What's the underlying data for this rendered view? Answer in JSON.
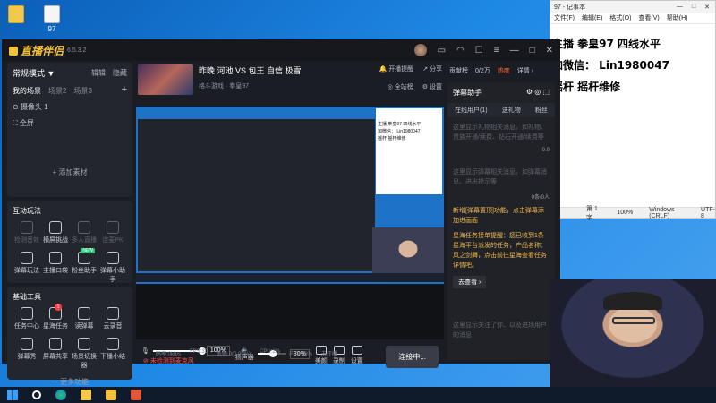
{
  "desktop": {
    "icons": [
      {
        "label": "",
        "kind": "file"
      },
      {
        "label": "97",
        "kind": "doc"
      }
    ]
  },
  "notepad": {
    "title": "97 - 记事本",
    "window_controls": [
      "—",
      "□",
      "✕"
    ],
    "menu": [
      "文件(F)",
      "编辑(E)",
      "格式(O)",
      "查看(V)",
      "帮助(H)"
    ],
    "lines": [
      "主播 拳皇97 四线水平",
      "加微信：  Lin1980047",
      "摇杆  摇杆维修"
    ],
    "status": {
      "position": "第 1 字",
      "zoom": "100%",
      "eol": "Windows (CRLF)",
      "encoding": "UTF-8"
    }
  },
  "app": {
    "logo": "直播伴侣",
    "version": "6.5.3.2",
    "titlebar_icons": [
      "avatar-icon",
      "chat-icon",
      "headset-icon",
      "feedback-icon",
      "menu-icon",
      "minimize-icon",
      "maximize-icon",
      "close-icon"
    ],
    "scenes": {
      "mode": "常规模式 ▼",
      "edit": "辑辑",
      "delete": "隐藏",
      "tabs": [
        "我的场景",
        "场景2",
        "场景3"
      ],
      "add": "+",
      "sources": [
        "摄像头 1",
        "全屏"
      ],
      "add_source": "+ 添加素材"
    },
    "interactive": {
      "title": "互动玩法",
      "tools": [
        {
          "label": "检测音效",
          "dim": true,
          "icon": "mic-icon"
        },
        {
          "label": "横屏挑战",
          "dim": false,
          "icon": "shield-icon"
        },
        {
          "label": "多人直播",
          "dim": true,
          "icon": "people-icon"
        },
        {
          "label": "连麦PK",
          "dim": true,
          "icon": "pk-icon"
        },
        {
          "label": "弹幕玩法",
          "dim": false,
          "icon": "download-icon"
        },
        {
          "label": "主播口袋",
          "dim": false,
          "icon": "pocket-icon"
        },
        {
          "label": "粉丝助手",
          "dim": false,
          "icon": "heart-icon",
          "badge": "NEW"
        },
        {
          "label": "弹幕小助手",
          "dim": false,
          "icon": "robot-icon"
        }
      ]
    },
    "basic": {
      "title": "基础工具",
      "tools": [
        {
          "label": "任务中心",
          "icon": "task-icon"
        },
        {
          "label": "星海任务",
          "icon": "ad-icon",
          "badge_num": "1"
        },
        {
          "label": "读弹幕",
          "icon": "read-icon"
        },
        {
          "label": "云录音",
          "icon": "cloud-icon"
        },
        {
          "label": "弹幕秀",
          "icon": "show-icon"
        },
        {
          "label": "屏幕共享",
          "icon": "share-icon"
        },
        {
          "label": "场景切换器",
          "icon": "switch-icon"
        },
        {
          "label": "下播小结",
          "icon": "summary-icon"
        }
      ],
      "more": "更多功能"
    },
    "stream": {
      "title": "昨晚 河池 VS 包王 自信 极雪",
      "category": "格斗游戏 · 拳皇97",
      "actions": [
        "开播提醒",
        "分享"
      ],
      "actions2": [
        "全站榜",
        "设置"
      ]
    },
    "preview_notepad_lines": [
      "主播 拳皇97 四线水平",
      "加微信： Lin1980047",
      "摇杆  摇杆维修"
    ],
    "controls": {
      "mic_volume": "100%",
      "speaker_volume": "30%",
      "speaker_label": "扬声器",
      "buttons": [
        "美颜",
        "录制",
        "设置"
      ],
      "live_button": "连接中...",
      "mic_warning": "未检测到麦克风"
    },
    "stats": [
      "码率:0kb/s",
      "FPS:30",
      "丢帧:0(0.00%)",
      "CPU:2%",
      "内存:36%",
      "未开播"
    ],
    "right_panel": {
      "top": [
        "贡献榜",
        "0/2万",
        "热度",
        "详情 ›"
      ],
      "chat_title": "弹幕助手",
      "tabs": [
        "在线用户(1)",
        "送礼物",
        "粉丝"
      ],
      "msg1": "这里显示礼物相关消息，如礼物、贵族开通/续费、钻石开通/续费等",
      "msg1_count": "0.0",
      "msg2": "这里显示弹幕相关消息，如弹幕消息、进出提示等",
      "msg2_count": "0条/0人",
      "notice": "新增[弹幕置顶]功能，点击弹幕添加进画面",
      "task": "星海任务接单提醒：您已收到1条星海平台派发的任务，产品名称：风之剑舞，点击前往星海查看任务详情吧。",
      "more_link": "去查看 ›",
      "msg3": "这里显示关注了你、以及进场用户的消息"
    }
  }
}
